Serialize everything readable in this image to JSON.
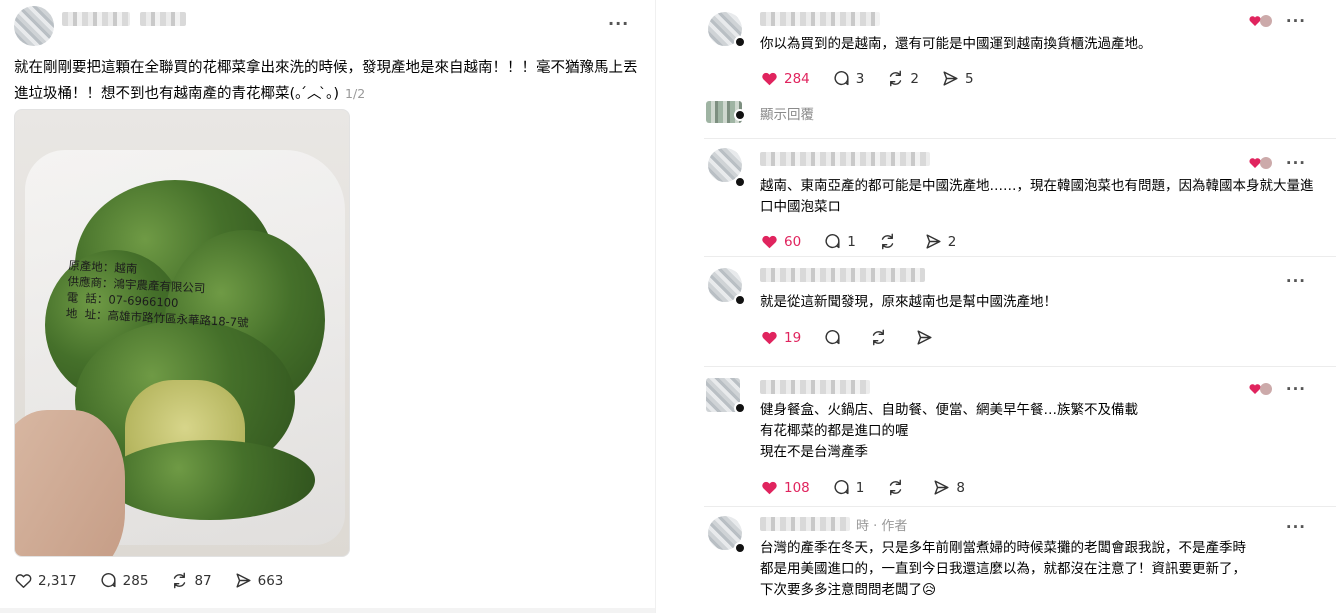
{
  "post": {
    "text": "就在剛剛要把這顆在全聯買的花椰菜拿出來洗的時候，發現產地是來自越南！！！毫不猶豫馬上丟進垃圾桶！！想不到也有越南產的青花椰菜(｡ ́︿ ̀｡)",
    "pager": "1/2",
    "photo_label_lines": [
      "原產地：越南",
      "供應商：鴻宇農產有限公司",
      "電  話：07-6966100",
      "地  址：高雄市路竹區永華路18-7號"
    ],
    "actions": {
      "likes": "2,317",
      "comments": "285",
      "reposts": "87",
      "shares": "663"
    }
  },
  "comments": [
    {
      "text": "你以為買到的是越南，還有可能是中國運到越南換貨櫃洗過產地。",
      "likes": "284",
      "replies": "3",
      "reposts": "2",
      "shares": "5",
      "liked": true,
      "author_liked": true
    },
    {
      "show_replies": "顯示回覆"
    },
    {
      "text": "越南、東南亞產的都可能是中國洗產地……，現在韓國泡菜也有問題，因為韓國本身就大量進口中國泡菜ロ",
      "likes": "60",
      "replies": "1",
      "reposts": "",
      "shares": "2",
      "liked": true,
      "author_liked": true
    },
    {
      "text": "就是從這新聞發現，原來越南也是幫中國洗產地！",
      "likes": "19",
      "replies": "",
      "reposts": "",
      "shares": "",
      "liked": true,
      "author_liked": false
    },
    {
      "text_lines": [
        "健身餐盒、火鍋店、自助餐、便當、網美早午餐…族繁不及備載",
        "有花椰菜的都是進口的喔",
        "現在不是台灣產季"
      ],
      "likes": "108",
      "replies": "1",
      "reposts": "",
      "shares": "8",
      "liked": true,
      "author_liked": true
    },
    {
      "meta": "時 · 作者",
      "text_lines": [
        "台灣的產季在冬天，只是多年前剛當煮婦的時候菜攤的老闆會跟我說，不是產季時",
        "都是用美國進口的，一直到今日我還這麼以為，就都沒在注意了！資訊要更新了，",
        "下次要多多注意問問老闆了😥"
      ]
    }
  ],
  "colors": {
    "like_red": "#e0245e",
    "text": "#000000",
    "muted": "#8a8a8a"
  }
}
